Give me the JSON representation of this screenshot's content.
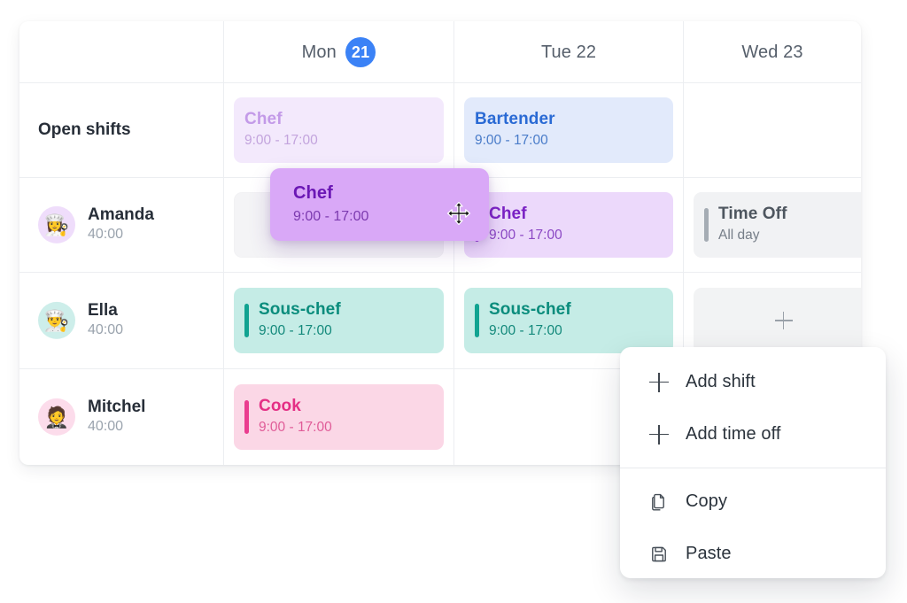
{
  "schedule": {
    "name_column_header": "",
    "days": [
      {
        "label": "Mon",
        "date": "21",
        "highlighted": true
      },
      {
        "label": "Tue 22",
        "date": "",
        "highlighted": false
      },
      {
        "label": "Wed 23",
        "date": "",
        "highlighted": false
      }
    ],
    "rows": [
      {
        "type": "open-shifts",
        "label": "Open shifts",
        "cells": {
          "mon": {
            "kind": "shift",
            "title": "Chef",
            "time": "9:00 - 17:00",
            "style": "purple-faded",
            "accent": false
          },
          "tue": {
            "kind": "shift",
            "title": "Bartender",
            "time": "9:00 - 17:00",
            "style": "blue",
            "accent": false
          },
          "wed": {
            "kind": "empty"
          }
        }
      },
      {
        "type": "employee",
        "name": "Amanda",
        "hours": "40:00",
        "avatar_emoji": "👩‍🍳",
        "avatar_color": "lav",
        "cells": {
          "mon": {
            "kind": "placeholder"
          },
          "tue": {
            "kind": "shift",
            "title": "Chef",
            "time": "9:00 - 17:00",
            "style": "purple",
            "accent": true
          },
          "wed": {
            "kind": "shift",
            "title": "Time Off",
            "time": "All day",
            "style": "gray",
            "accent": true
          }
        }
      },
      {
        "type": "employee",
        "name": "Ella",
        "hours": "40:00",
        "avatar_emoji": "👨‍🍳",
        "avatar_color": "mint",
        "cells": {
          "mon": {
            "kind": "shift",
            "title": "Sous-chef",
            "time": "9:00 - 17:00",
            "style": "teal",
            "accent": true
          },
          "tue": {
            "kind": "shift",
            "title": "Sous-chef",
            "time": "9:00 - 17:00",
            "style": "teal",
            "accent": true
          },
          "wed": {
            "kind": "add-slot",
            "icon": "plus-icon"
          }
        }
      },
      {
        "type": "employee",
        "name": "Mitchel",
        "hours": "40:00",
        "avatar_emoji": "🤵",
        "avatar_color": "pink",
        "cells": {
          "mon": {
            "kind": "shift",
            "title": "Cook",
            "time": "9:00 - 17:00",
            "style": "rose",
            "accent": true
          },
          "tue": {
            "kind": "empty"
          },
          "wed": {
            "kind": "empty"
          }
        }
      }
    ]
  },
  "drag": {
    "title": "Chef",
    "time": "9:00 - 17:00",
    "cursor": "move-cursor"
  },
  "context_menu": {
    "items": [
      {
        "label": "Add shift",
        "icon": "plus-icon"
      },
      {
        "label": "Add time off",
        "icon": "plus-icon"
      },
      {
        "label": "Copy",
        "icon": "copy-icon"
      },
      {
        "label": "Paste",
        "icon": "save-disk-icon"
      }
    ]
  },
  "colors": {
    "day_badge": "#3b82f6",
    "chef_purple": "#8b2fd0",
    "bartender_blue": "#2a6ad4",
    "sous_chef_teal": "#11a391",
    "cook_rose": "#ea3d8f",
    "time_off_gray": "#a5acb4",
    "drag_card": "#d9a8f7"
  }
}
